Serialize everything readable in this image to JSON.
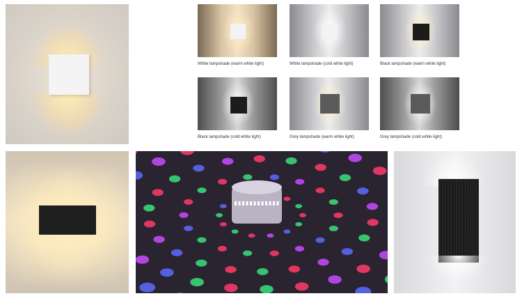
{
  "products": [
    {
      "caption": "White lampshade (warm white light)"
    },
    {
      "caption": "White lampshade (cold white light)"
    },
    {
      "caption": "Black lampshade (warm white light)"
    },
    {
      "caption": "Black lampshade (cold white light)"
    },
    {
      "caption": "Grey lampshade (warm white light)"
    },
    {
      "caption": "Grey lampshade (cold white light)"
    }
  ],
  "colors": {
    "warm_light": "#ffe9b4",
    "cold_light": "#ffffff",
    "fixture_black": "#1c1c1c",
    "fixture_grey": "#5a5a5a"
  }
}
